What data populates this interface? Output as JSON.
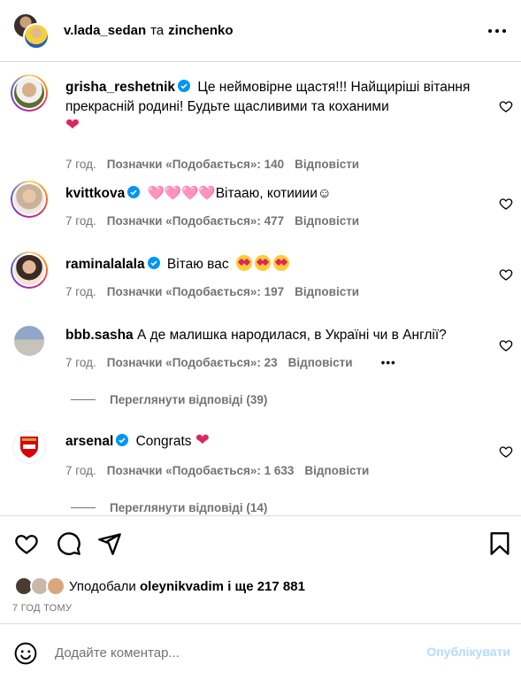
{
  "header": {
    "user1": "v.lada_sedan",
    "separator": "та",
    "user2": "zinchenko"
  },
  "comments": [
    {
      "username": "grisha_reshetnik",
      "text": "Це неймовірне щастя!!! Найщиріші вітання прекрасній родині! Будьте щасливими та коханими",
      "suffix": "❤",
      "time": "7 год.",
      "likes": "Позначки «Подобається»: 140",
      "reply": "Відповісти"
    },
    {
      "username": "kvittkova",
      "text": "🩷🩷🩷🩷Вітааю, котииии☺",
      "time": "7 год.",
      "likes": "Позначки «Подобається»: 477",
      "reply": "Відповісти"
    },
    {
      "username": "raminalalala",
      "text": "Вітаю вас",
      "time": "7 год.",
      "likes": "Позначки «Подобається»: 197",
      "reply": "Відповісти"
    },
    {
      "username": "bbb.sasha",
      "text": "А де малишка народилася, в Україні чи в Англії?",
      "time": "7 год.",
      "likes": "Позначки «Подобається»: 23",
      "reply": "Відповісти",
      "view_replies": "Переглянути відповіді (39)"
    },
    {
      "username": "arsenal",
      "text": "Congrats",
      "suffix": "❤",
      "time": "7 год.",
      "likes": "Позначки «Подобається»: 1 633",
      "reply": "Відповісти",
      "view_replies": "Переглянути відповіді (14)"
    }
  ],
  "likes_bar": {
    "prefix": "Уподобали",
    "user": "oleynikvadim",
    "rest": "і ще 217 881"
  },
  "time_ago": "7 ГОД ТОМУ",
  "comment_box": {
    "placeholder": "Додайте коментар...",
    "publish": "Опублікувати"
  },
  "colors": {
    "accent": "#0095f6",
    "publish_disabled": "#b3dbff",
    "muted": "#737373",
    "heart": "#e0245e"
  }
}
